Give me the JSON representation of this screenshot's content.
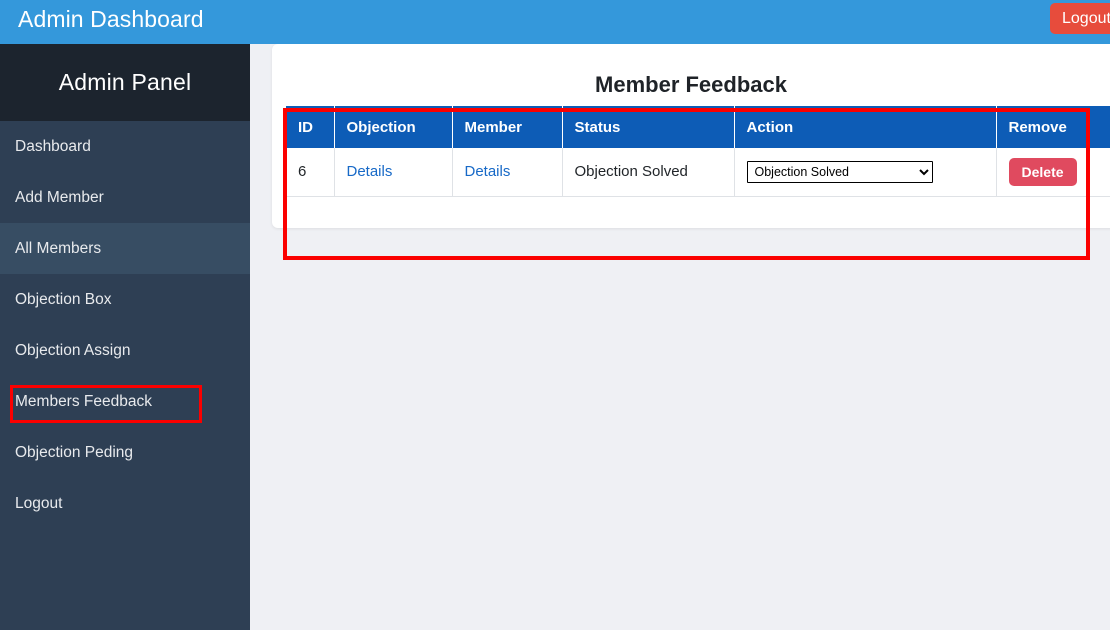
{
  "topbar": {
    "brand": "Admin Dashboard",
    "logout_label": "Logout",
    "background": "#3498db",
    "logout_color": "#e74c3c"
  },
  "sidebar": {
    "title": "Admin Panel",
    "background": "#2e3f54",
    "header_background": "#1c242e",
    "active_background": "#374d63",
    "items": [
      {
        "label": "Dashboard",
        "name": "sidebar-item-dashboard",
        "active": false,
        "annotated": false
      },
      {
        "label": "Add Member",
        "name": "sidebar-item-add-member",
        "active": false,
        "annotated": false
      },
      {
        "label": "All Members",
        "name": "sidebar-item-all-members",
        "active": true,
        "annotated": false
      },
      {
        "label": "Objection Box",
        "name": "sidebar-item-objection-box",
        "active": false,
        "annotated": false
      },
      {
        "label": "Objection Assign",
        "name": "sidebar-item-objection-assign",
        "active": false,
        "annotated": false
      },
      {
        "label": "Members Feedback",
        "name": "sidebar-item-members-feedback",
        "active": false,
        "annotated": true
      },
      {
        "label": "Objection Peding",
        "name": "sidebar-item-objection-pending",
        "active": false,
        "annotated": false
      },
      {
        "label": "Logout",
        "name": "sidebar-item-logout",
        "active": false,
        "annotated": false
      }
    ]
  },
  "main": {
    "page_title": "Member Feedback",
    "background": "#eff0f4",
    "table": {
      "header_background": "#0d5cb6",
      "columns": [
        "ID",
        "Objection",
        "Member",
        "Status",
        "Action",
        "Remove"
      ],
      "rows": [
        {
          "id": "6",
          "objection_link": "Details",
          "member_link": "Details",
          "status": "Objection Solved",
          "action_select_value": "Objection Solved",
          "action_select_options": [
            "Objection Solved"
          ],
          "remove_label": "Delete"
        }
      ]
    }
  },
  "annotations": {
    "color": "#fb0000",
    "table_highlight": "Member Feedback table",
    "sidebar_highlight": "Members Feedback"
  }
}
